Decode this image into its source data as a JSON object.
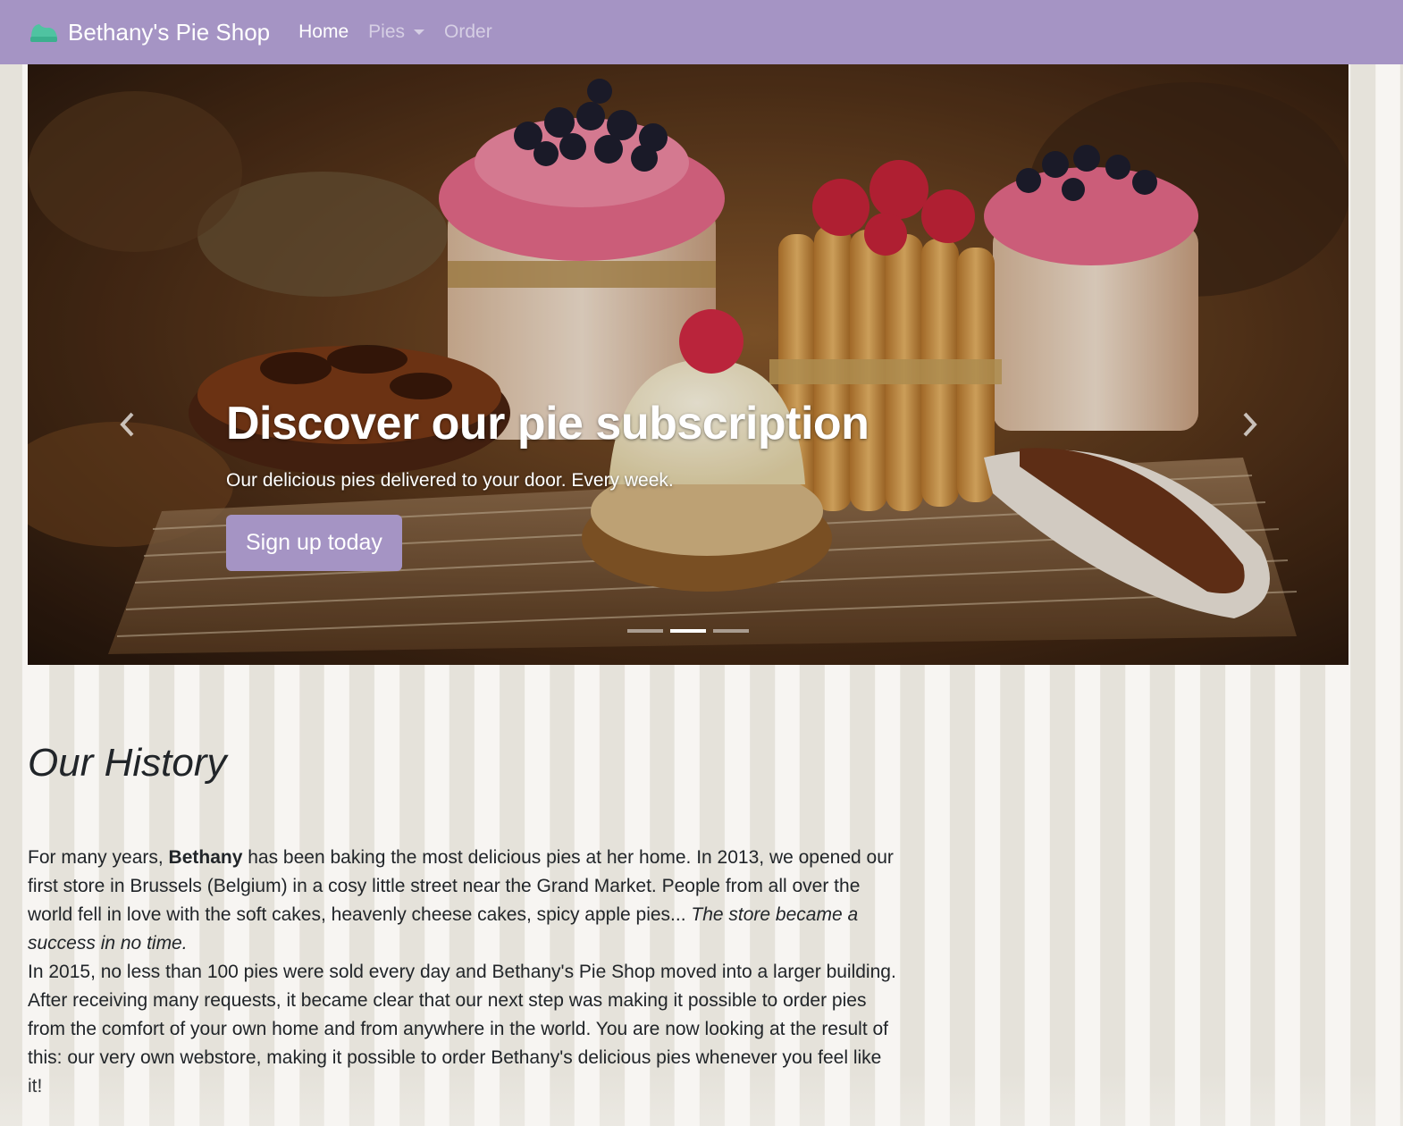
{
  "navbar": {
    "brand": "Bethany's Pie Shop",
    "logo_icon": "pie-icon",
    "links": [
      {
        "label": "Home",
        "active": true
      },
      {
        "label": "Pies",
        "dropdown": true
      },
      {
        "label": "Order"
      }
    ],
    "color": "#a594c4"
  },
  "carousel": {
    "slide": {
      "title": "Discover our pie subscription",
      "subtitle": "Our delicious pies delivered to your door. Every week.",
      "button": "Sign up today"
    },
    "indicator_count": 3,
    "active_indicator": 1,
    "prev_icon": "chevron-left-icon",
    "next_icon": "chevron-right-icon"
  },
  "history": {
    "heading": "Our History",
    "p1_before_bold": "For many years, ",
    "p1_bold": "Bethany",
    "p1_after_bold": " has been baking the most delicious pies at her home. In 2013, we opened our first store in Brussels (Belgium) in a cosy little street near the Grand Market. People from all over the world fell in love with the soft cakes, heavenly cheese cakes, spicy apple pies... ",
    "p1_italic": "The store became a success in no time.",
    "p2": "In 2015, no less than 100 pies were sold every day and Bethany's Pie Shop moved into a larger building. After receiving many requests, it became clear that our next step was making it possible to order pies from the comfort of your own home and from anywhere in the world. You are now looking at the result of this: our very own webstore, making it possible to order Bethany's delicious pies whenever you feel like it!"
  },
  "colors": {
    "accent": "#a594c4",
    "stripe_light": "#f7f5f2",
    "stripe_dark": "#e5e2da"
  }
}
